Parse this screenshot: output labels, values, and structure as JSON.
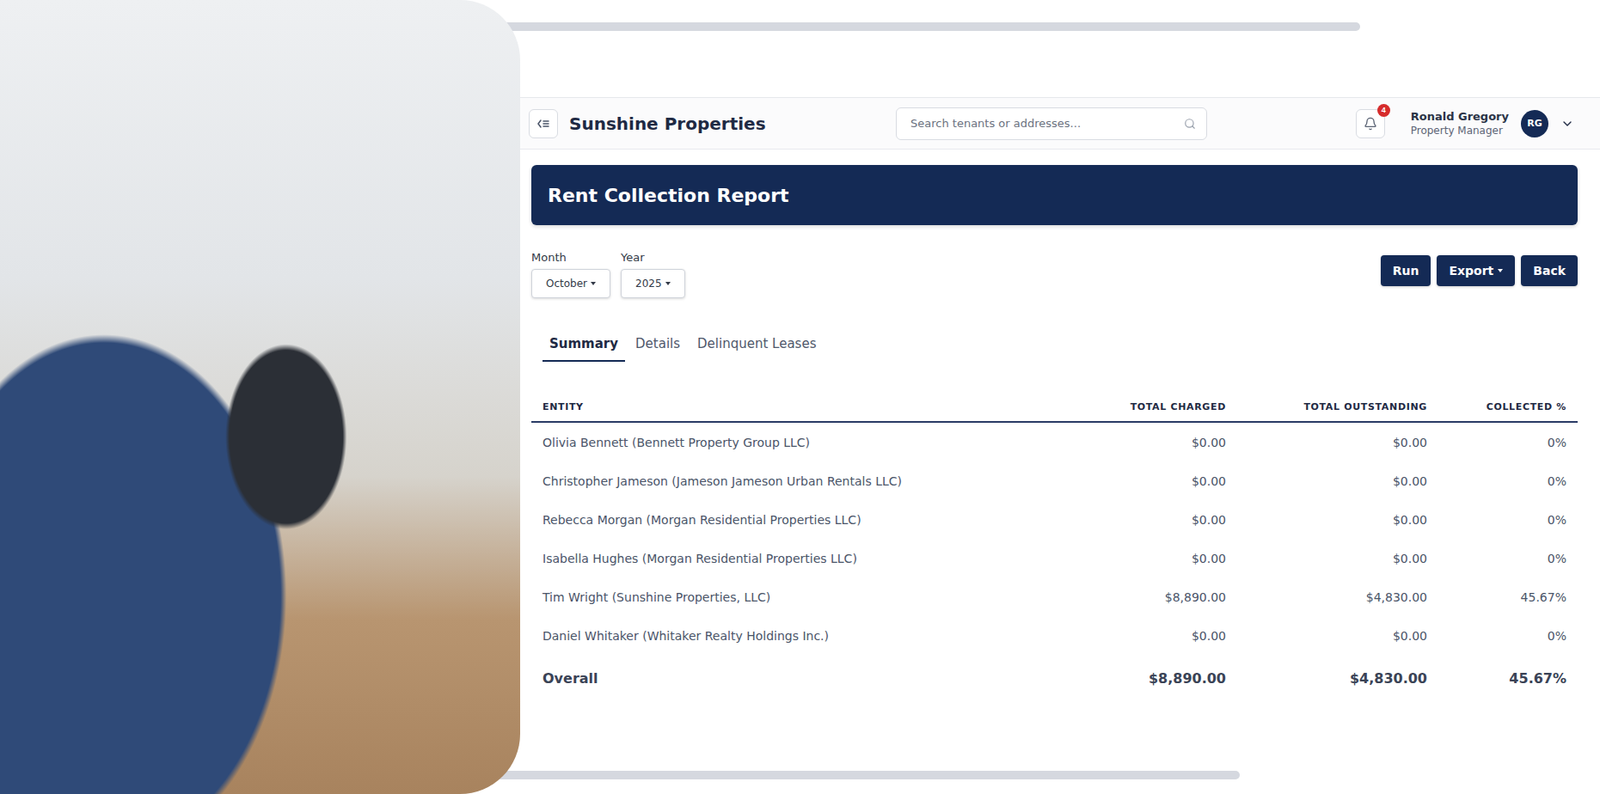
{
  "header": {
    "title": "Sunshine Properties",
    "search": {
      "placeholder": "Search tenants or addresses..."
    },
    "notifications": {
      "count": "4"
    },
    "user": {
      "name": "Ronald Gregory",
      "role": "Property Manager",
      "initials": "RG"
    }
  },
  "report": {
    "title": "Rent Collection Report"
  },
  "filters": [
    {
      "label": "Month",
      "value": "October"
    },
    {
      "label": "Year",
      "value": "2025"
    }
  ],
  "actions": [
    {
      "label": "Run",
      "kind": "button"
    },
    {
      "label": "Export",
      "kind": "dropdown"
    },
    {
      "label": "Back",
      "kind": "button"
    }
  ],
  "tabs": [
    {
      "label": "Summary",
      "selected": true
    },
    {
      "label": "Details",
      "selected": false
    },
    {
      "label": "Delinquent Leases",
      "selected": false
    }
  ],
  "table": {
    "columns": [
      "ENTITY",
      "TOTAL CHARGED",
      "TOTAL OUTSTANDING",
      "COLLECTED %"
    ],
    "rows": [
      {
        "entity": "Olivia Bennett (Bennett Property Group LLC)",
        "charged": "$0.00",
        "outstanding": "$0.00",
        "collected": "0%"
      },
      {
        "entity": "Christopher Jameson (Jameson Jameson Urban Rentals LLC)",
        "charged": "$0.00",
        "outstanding": "$0.00",
        "collected": "0%"
      },
      {
        "entity": "Rebecca Morgan (Morgan Residential Properties LLC)",
        "charged": "$0.00",
        "outstanding": "$0.00",
        "collected": "0%"
      },
      {
        "entity": "Isabella Hughes (Morgan Residential Properties LLC)",
        "charged": "$0.00",
        "outstanding": "$0.00",
        "collected": "0%"
      },
      {
        "entity": "Tim Wright (Sunshine Properties, LLC)",
        "charged": "$8,890.00",
        "outstanding": "$4,830.00",
        "collected": "45.67%"
      },
      {
        "entity": "Daniel Whitaker (Whitaker Realty Holdings Inc.)",
        "charged": "$0.00",
        "outstanding": "$0.00",
        "collected": "0%"
      }
    ],
    "total": {
      "entity": "Overall",
      "charged": "$8,890.00",
      "outstanding": "$4,830.00",
      "collected": "45.67%"
    }
  }
}
